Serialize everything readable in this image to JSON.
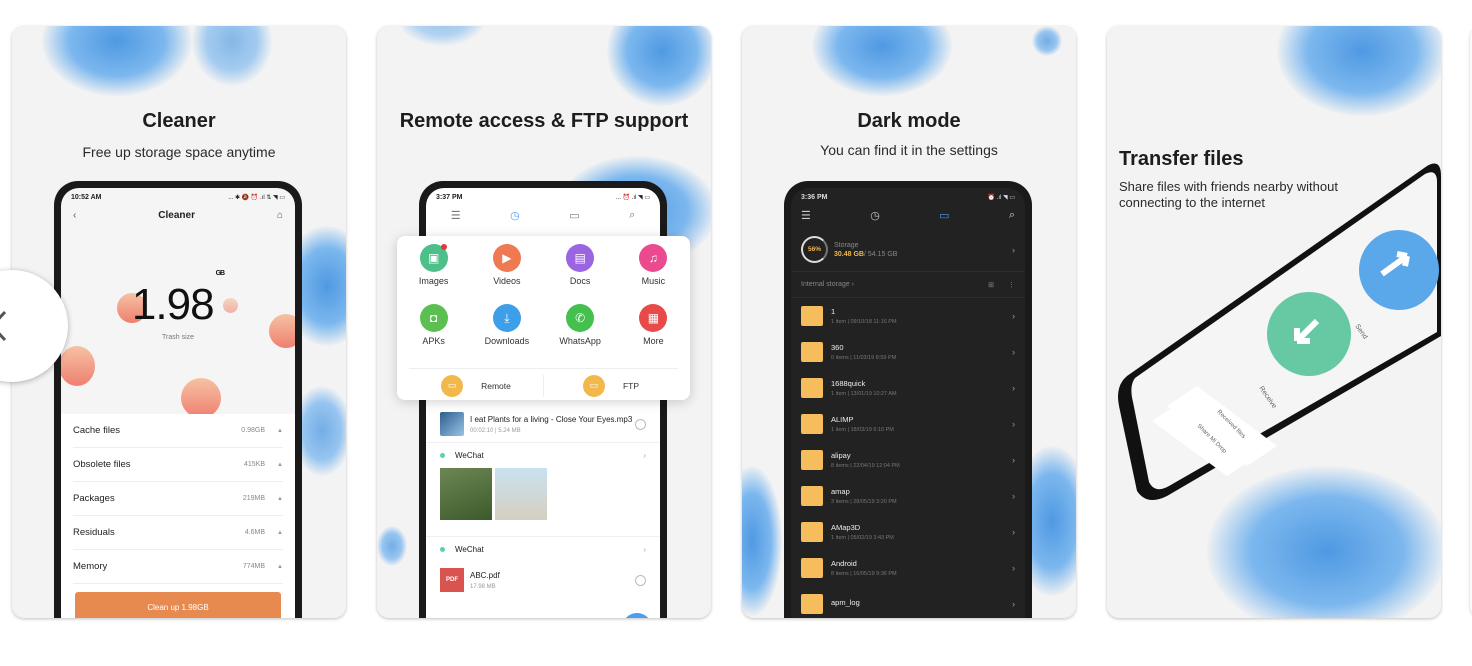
{
  "carousel": {
    "prev_button": "previous-screenshot",
    "cards": [
      {
        "title": "Cleaner",
        "subtitle": "Free up storage space anytime",
        "phone": {
          "time": "10:52 AM",
          "status_icons": "... ✱ 🔕 ⏰ .ıl ⇅ ◥ ▭",
          "header_title": "Cleaner",
          "trash_value": "1.98",
          "trash_unit": "GB",
          "trash_label": "Trash size",
          "items": [
            {
              "label": "Cache files",
              "value": "0.98GB"
            },
            {
              "label": "Obsolete files",
              "value": "415KB"
            },
            {
              "label": "Packages",
              "value": "219MB"
            },
            {
              "label": "Residuals",
              "value": "4.6MB"
            },
            {
              "label": "Memory",
              "value": "774MB"
            }
          ],
          "clean_button": "Clean up 1.98GB"
        }
      },
      {
        "title": "Remote access & FTP support",
        "phone": {
          "time": "3:37 PM",
          "categories": [
            {
              "label": "Images",
              "color": "#4dbf8a",
              "icon": "▣"
            },
            {
              "label": "Videos",
              "color": "#ef7a52",
              "icon": "▶"
            },
            {
              "label": "Docs",
              "color": "#9b64e0",
              "icon": "▤"
            },
            {
              "label": "Music",
              "color": "#ec4a8f",
              "icon": "♫"
            },
            {
              "label": "APKs",
              "color": "#5cbf52",
              "icon": "◘"
            },
            {
              "label": "Downloads",
              "color": "#3d9fe8",
              "icon": "⤓"
            },
            {
              "label": "WhatsApp",
              "color": "#45c04e",
              "icon": "✆"
            },
            {
              "label": "More",
              "color": "#e84a4a",
              "icon": "▦"
            }
          ],
          "remote_label": "Remote",
          "ftp_label": "FTP",
          "file1_name": "I eat Plants for a living - Close Your Eyes.mp3",
          "file1_meta": "00:02:10 | 5.24 MB",
          "section1": "WeChat",
          "section2": "WeChat",
          "file2_name": "ABC.pdf",
          "file2_meta": "17.98 MB",
          "pdf_badge": "PDF"
        }
      },
      {
        "title": "Dark mode",
        "subtitle": "You can find it in the settings",
        "phone": {
          "time": "3:36 PM",
          "storage_percent": "56%",
          "storage_label": "Storage",
          "storage_used": "30.48 GB",
          "storage_total": "/ 54.15 GB",
          "internal_storage": "Internal storage ›",
          "folders": [
            {
              "name": "1",
              "meta": "1 item | 09/10/18 11:16 PM"
            },
            {
              "name": "360",
              "meta": "0 items | 11/03/19 8:59 PM"
            },
            {
              "name": "1688quick",
              "meta": "1 item | 13/01/19 10:27 AM"
            },
            {
              "name": "ALIMP",
              "meta": "1 item | 18/03/19 6:10 PM"
            },
            {
              "name": "alipay",
              "meta": "8 items | 22/04/19 12:04 PM"
            },
            {
              "name": "amap",
              "meta": "3 items | 28/05/19 3:20 PM"
            },
            {
              "name": "AMap3D",
              "meta": "1 item | 05/02/19 3:43 PM"
            },
            {
              "name": "Android",
              "meta": "8 items | 16/05/19 9:36 PM"
            },
            {
              "name": "apm_log",
              "meta": ""
            }
          ]
        }
      },
      {
        "title": "Transfer files",
        "subtitle": "Share files with friends nearby without connecting to the internet",
        "phone": {
          "send_label": "Send",
          "receive_label": "Receive",
          "received_files": "Received files",
          "share_mi_drop": "Share Mi Drop"
        }
      }
    ]
  }
}
